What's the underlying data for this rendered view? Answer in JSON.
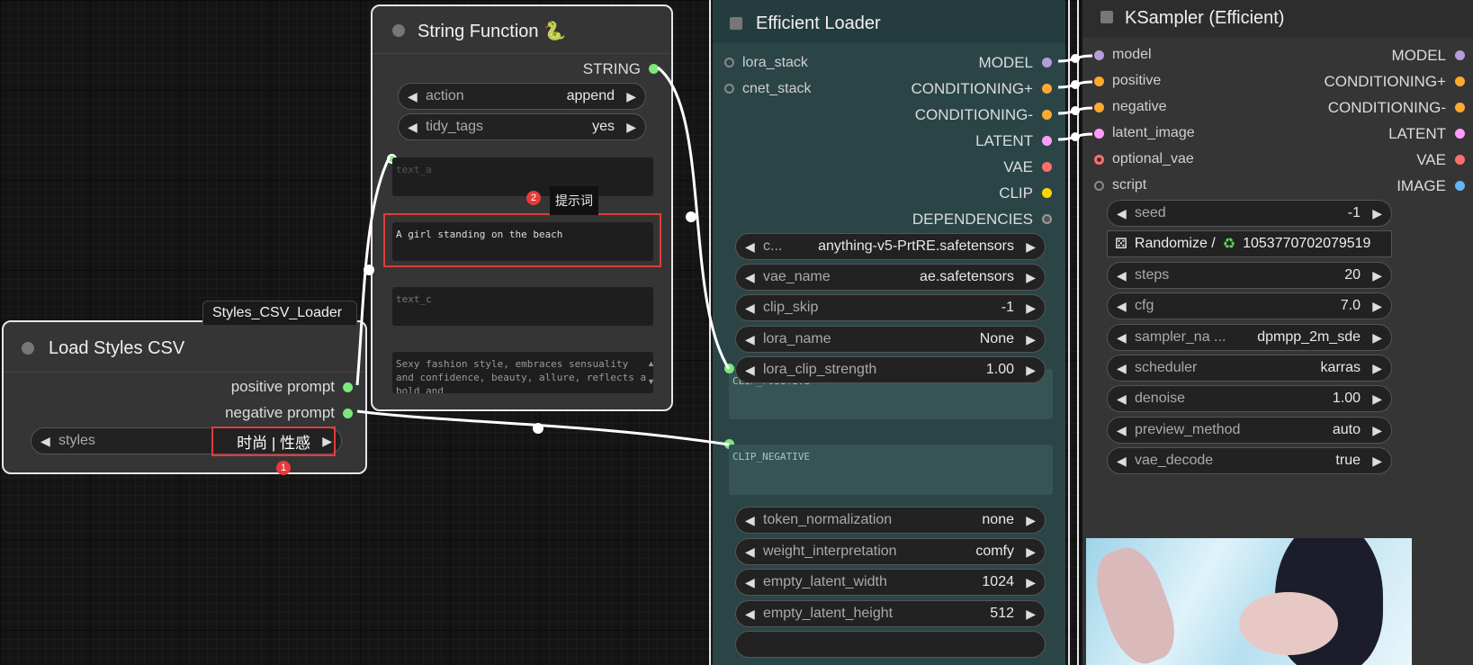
{
  "styles_loader_tag": "Styles_CSV_Loader",
  "load_styles": {
    "title": "Load Styles CSV",
    "outputs": [
      "positive prompt",
      "negative prompt"
    ],
    "widget": {
      "name": "styles",
      "value": "时尚 | 性感"
    }
  },
  "string_function": {
    "title": "String Function 🐍",
    "output": "STRING",
    "widgets": [
      {
        "name": "action",
        "value": "append"
      },
      {
        "name": "tidy_tags",
        "value": "yes"
      }
    ],
    "text_a_placeholder": "text_a",
    "text_b_value": "A girl standing on the beach",
    "text_c_placeholder": "text_c",
    "text_d_value": "Sexy fashion style, embraces sensuality and confidence, beauty, allure, reflects a bold and"
  },
  "annotations": {
    "badge1": "1",
    "badge2": "2",
    "tooltip": "提示词"
  },
  "efficient_loader": {
    "title": "Efficient Loader",
    "inputs": [
      "lora_stack",
      "cnet_stack"
    ],
    "outputs": [
      "MODEL",
      "CONDITIONING+",
      "CONDITIONING-",
      "LATENT",
      "VAE",
      "CLIP",
      "DEPENDENCIES"
    ],
    "widgets": [
      {
        "name": "c...",
        "value": "anything-v5-PrtRE.safetensors"
      },
      {
        "name": "vae_name",
        "value": "ae.safetensors"
      },
      {
        "name": "clip_skip",
        "value": "-1"
      },
      {
        "name": "lora_name",
        "value": "None"
      },
      {
        "name": "lora_clip_strength",
        "value": "1.00"
      }
    ],
    "clip_positive": "CLIP_POSITIVE",
    "clip_negative": "CLIP_NEGATIVE",
    "widgets2": [
      {
        "name": "token_normalization",
        "value": "none"
      },
      {
        "name": "weight_interpretation",
        "value": "comfy"
      },
      {
        "name": "empty_latent_width",
        "value": "1024"
      },
      {
        "name": "empty_latent_height",
        "value": "512"
      }
    ]
  },
  "ksampler": {
    "title": "KSampler (Efficient)",
    "inputs": [
      "model",
      "positive",
      "negative",
      "latent_image",
      "optional_vae",
      "script"
    ],
    "outputs": [
      "MODEL",
      "CONDITIONING+",
      "CONDITIONING-",
      "LATENT",
      "VAE",
      "IMAGE"
    ],
    "seed": {
      "name": "seed",
      "value": "-1"
    },
    "randomize": {
      "label": "Randomize /",
      "value": "1053770702079519"
    },
    "widgets": [
      {
        "name": "steps",
        "value": "20"
      },
      {
        "name": "cfg",
        "value": "7.0"
      },
      {
        "name": "sampler_na ...",
        "value": "dpmpp_2m_sde"
      },
      {
        "name": "scheduler",
        "value": "karras"
      },
      {
        "name": "denoise",
        "value": "1.00"
      },
      {
        "name": "preview_method",
        "value": "auto"
      },
      {
        "name": "vae_decode",
        "value": "true"
      }
    ]
  },
  "colors": {
    "model": "#b39ddb",
    "conditioning": "#ffa931",
    "latent": "#ff9cf9",
    "vae": "#ff6e6e",
    "clip": "#ffd500",
    "image": "#64b5f6",
    "string": "#7be87b"
  }
}
